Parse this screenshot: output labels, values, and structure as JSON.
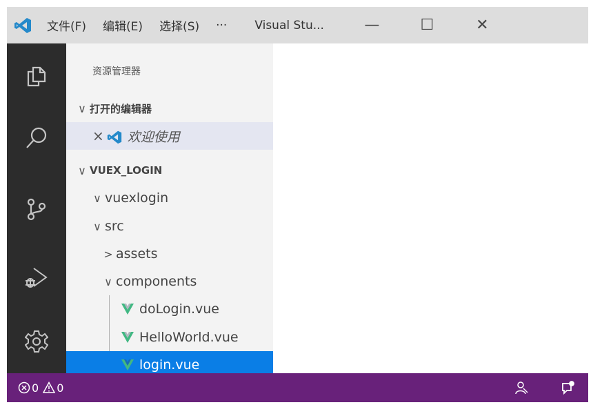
{
  "titlebar": {
    "menu": [
      "文件(F)",
      "编辑(E)",
      "选择(S)",
      "···"
    ],
    "title": "Visual Stu...",
    "minimize": "—",
    "maximize": "☐",
    "close": "✕"
  },
  "activity": [
    "explorer-icon",
    "search-icon",
    "source-control-icon",
    "debug-icon",
    "settings-gear-icon"
  ],
  "sidebar": {
    "title": "资源管理器",
    "open_editors_label": "打开的编辑器",
    "open_editor_item": "欢迎使用",
    "project_label": "VUEX_LOGIN",
    "tree": [
      {
        "label": "vuexlogin",
        "chevron": "∨"
      },
      {
        "label": "src",
        "chevron": "∨"
      },
      {
        "label": "assets",
        "chevron": ">"
      },
      {
        "label": "components",
        "chevron": "∨"
      },
      {
        "label": "doLogin.vue"
      },
      {
        "label": "HelloWorld.vue"
      },
      {
        "label": "login.vue"
      }
    ]
  },
  "statusbar": {
    "errors": "0",
    "warnings": "0"
  },
  "colors": {
    "titlebar": "#dddddd",
    "activitybar": "#2c2c2c",
    "sidebar": "#f3f3f3",
    "selection": "#0a7ee6",
    "statusbar": "#68217a",
    "vscode_blue": "#2489ca",
    "vue_green": "#41b883"
  }
}
